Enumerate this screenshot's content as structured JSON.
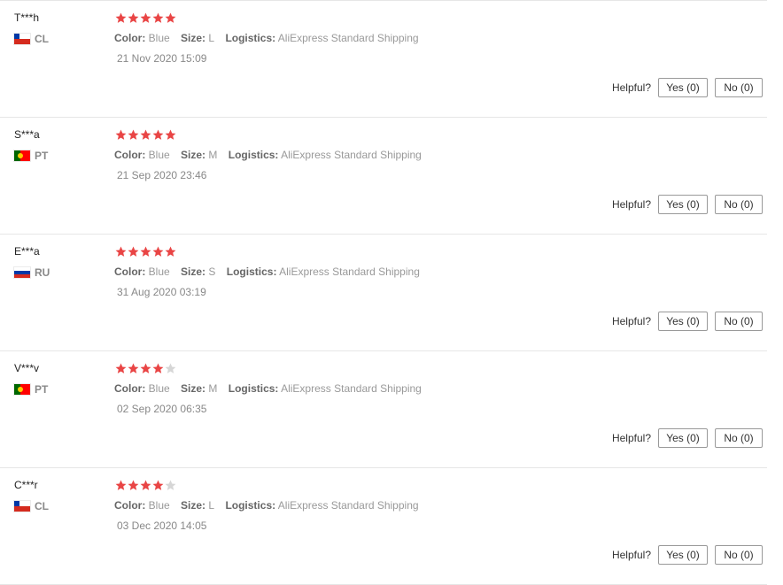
{
  "labels": {
    "color": "Color:",
    "size": "Size:",
    "logistics": "Logistics:",
    "helpful": "Helpful?"
  },
  "colors": {
    "star_filled": "#e94545",
    "star_empty": "#d6d6d6",
    "divider": "#e6e6e6"
  },
  "reviews": [
    {
      "user": "T***h",
      "country": "CL",
      "flag_icon": "flag-cl",
      "rating": 5,
      "color": "Blue",
      "size": "L",
      "logistics": "AliExpress Standard Shipping",
      "date": "21 Nov 2020 15:09",
      "yes": "Yes (0)",
      "no": "No (0)"
    },
    {
      "user": "S***a",
      "country": "PT",
      "flag_icon": "flag-pt",
      "rating": 5,
      "color": "Blue",
      "size": "M",
      "logistics": "AliExpress Standard Shipping",
      "date": "21 Sep 2020 23:46",
      "yes": "Yes (0)",
      "no": "No (0)"
    },
    {
      "user": "E***a",
      "country": "RU",
      "flag_icon": "flag-ru",
      "rating": 5,
      "color": "Blue",
      "size": "S",
      "logistics": "AliExpress Standard Shipping",
      "date": "31 Aug 2020 03:19",
      "yes": "Yes (0)",
      "no": "No (0)"
    },
    {
      "user": "V***v",
      "country": "PT",
      "flag_icon": "flag-pt",
      "rating": 4,
      "color": "Blue",
      "size": "M",
      "logistics": "AliExpress Standard Shipping",
      "date": "02 Sep 2020 06:35",
      "yes": "Yes (0)",
      "no": "No (0)"
    },
    {
      "user": "C***r",
      "country": "CL",
      "flag_icon": "flag-cl",
      "rating": 4,
      "color": "Blue",
      "size": "L",
      "logistics": "AliExpress Standard Shipping",
      "date": "03 Dec 2020 14:05",
      "yes": "Yes (0)",
      "no": "No (0)"
    }
  ]
}
